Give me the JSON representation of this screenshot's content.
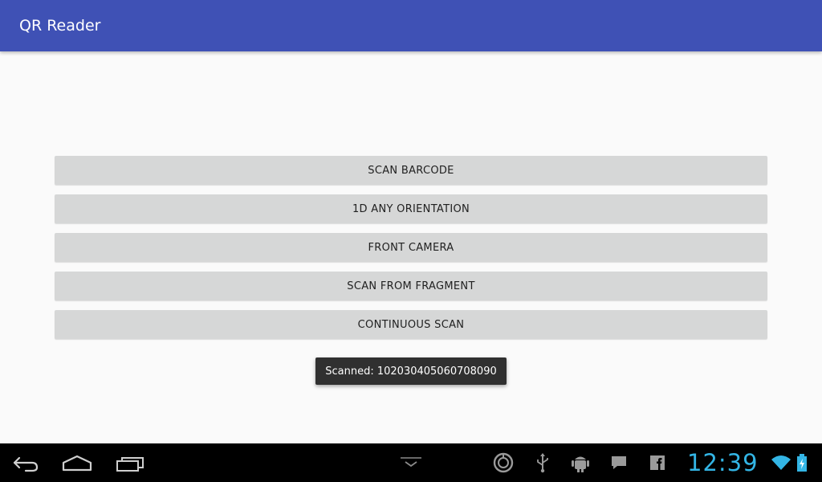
{
  "app": {
    "title": "QR Reader",
    "primary_color": "#3f51b5"
  },
  "buttons": [
    {
      "label": "SCAN BARCODE"
    },
    {
      "label": "1D ANY ORIENTATION"
    },
    {
      "label": "FRONT CAMERA"
    },
    {
      "label": "SCAN FROM FRAGMENT"
    },
    {
      "label": "CONTINUOUS SCAN"
    }
  ],
  "toast": {
    "text": "Scanned: 102030405060708090"
  },
  "system_bar": {
    "clock": "12:39",
    "clock_color": "#33b5e5",
    "nav_icons": [
      "back-icon",
      "home-icon",
      "recent-apps-icon",
      "hide-keyboard-icon"
    ],
    "status_icons": [
      "sync-icon",
      "usb-icon",
      "android-debug-icon",
      "message-icon",
      "facebook-icon",
      "wifi-icon",
      "battery-icon"
    ]
  }
}
